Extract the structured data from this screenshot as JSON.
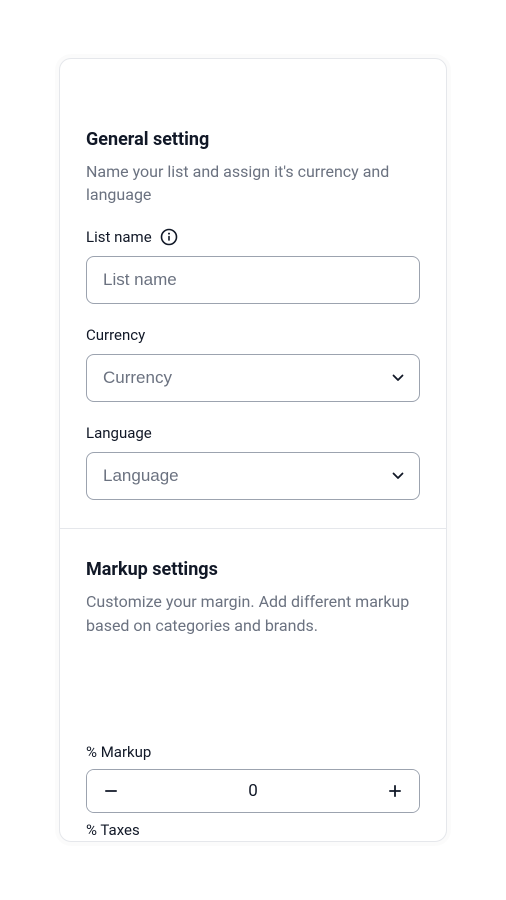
{
  "general": {
    "title": "General setting",
    "description": "Name your list and assign it's currency and language",
    "listName": {
      "label": "List name",
      "placeholder": "List name",
      "value": ""
    },
    "currency": {
      "label": "Currency",
      "placeholder": "Currency"
    },
    "language": {
      "label": "Language",
      "placeholder": "Language"
    }
  },
  "markup": {
    "title": "Markup settings",
    "description": "Customize your margin. Add different markup based on categories and brands.",
    "markupField": {
      "label": "% Markup",
      "value": "0"
    },
    "taxesField": {
      "label": "% Taxes"
    }
  }
}
